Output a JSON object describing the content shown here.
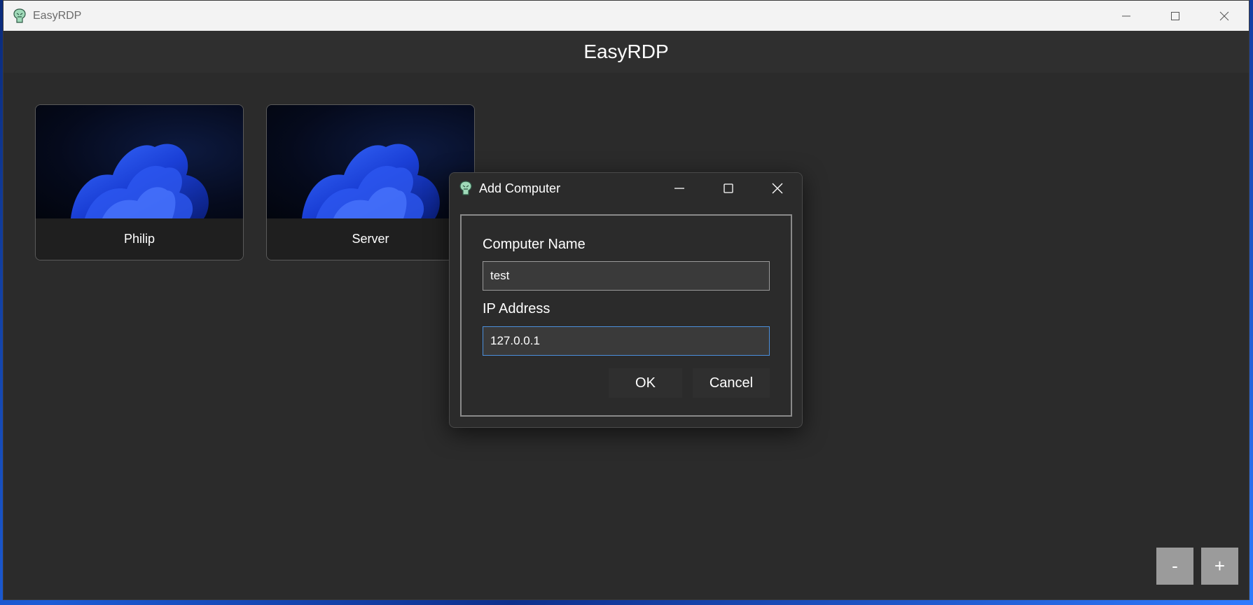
{
  "window": {
    "title": "EasyRDP",
    "app_icon": "app-logo-icon"
  },
  "header": {
    "title": "EasyRDP"
  },
  "computers": [
    {
      "name": "Philip",
      "thumbnail": "windows-wallpaper"
    },
    {
      "name": "Server",
      "thumbnail": "windows-wallpaper"
    }
  ],
  "corner_buttons": {
    "remove_label": "-",
    "add_label": "+"
  },
  "dialog": {
    "title": "Add Computer",
    "computer_name_label": "Computer Name",
    "computer_name_value": "test",
    "ip_label": "IP Address",
    "ip_value": "127.0.0.1",
    "ok_label": "OK",
    "cancel_label": "Cancel"
  },
  "colors": {
    "window_bg": "#2b2b2b",
    "titlebar_bg": "#f3f3f3",
    "focus_border": "#4b8fdc",
    "corner_button_bg": "#9b9b9b"
  }
}
